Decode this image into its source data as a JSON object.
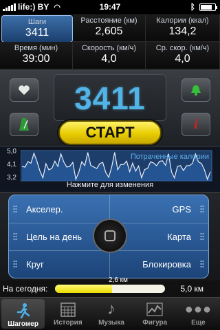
{
  "status_bar": {
    "carrier": "life:) BY",
    "time": "19:47"
  },
  "stats": {
    "steps": {
      "label": "Шаги",
      "value": "3411"
    },
    "distance": {
      "label": "Расстояние (км)",
      "value": "2,605"
    },
    "calories": {
      "label": "Калории (ккал)",
      "value": "134,2"
    },
    "time": {
      "label": "Время (мин)",
      "value": "39:00"
    },
    "speed": {
      "label": "Скорость (км/ч)",
      "value": "4,0"
    },
    "avg_speed": {
      "label": "Ср. скор. (км/ч)",
      "value": "4,0"
    }
  },
  "main": {
    "step_count": "3411",
    "start_label": "СТАРТ"
  },
  "graph": {
    "y_labels": [
      "5,0",
      "4,1",
      "3,2"
    ],
    "caption_top": "Потраченные калории",
    "caption_bottom": "Нажмите для изменения",
    "line_color": "#e8eef7",
    "fill_color": "#2a5ea4"
  },
  "menu": {
    "accelerometer": "Акселер.",
    "gps": "GPS",
    "daily_goal": "Цель на день",
    "map": "Карта",
    "lap": "Круг",
    "lock": "Блокировка"
  },
  "progress": {
    "today_label": "На сегодня:",
    "current": "2,6 км",
    "goal": "5,0 км",
    "fraction": 0.52
  },
  "tabs": [
    {
      "label": "Шагомер",
      "icon": "pedometer-runner-icon"
    },
    {
      "label": "История",
      "icon": "calendar-grid-icon"
    },
    {
      "label": "Музыка",
      "icon": "music-note-icon"
    },
    {
      "label": "Фигура",
      "icon": "chart-line-icon"
    },
    {
      "label": "Еще",
      "icon": "more-dots-icon"
    }
  ],
  "colors": {
    "accent_blue": "#52b3e6",
    "start_yellow": "#f2de00",
    "selected_cell": "#3d6fa8",
    "bell_green": "#35c23a",
    "info_red": "#e01a1a"
  }
}
